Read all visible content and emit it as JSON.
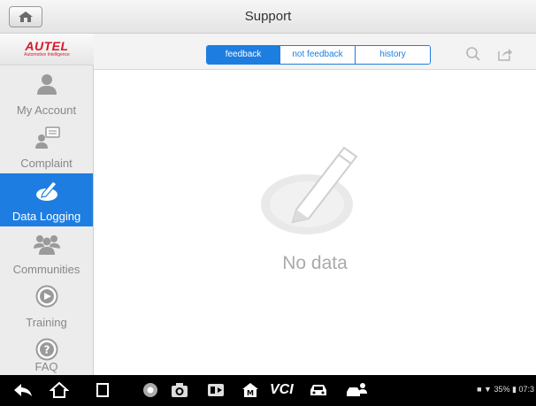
{
  "window": {
    "title": "Support"
  },
  "logo": {
    "brand": "AUTEL",
    "tagline": "Automotive Intelligence"
  },
  "sidebar": {
    "items": [
      {
        "label": "My Account",
        "icon": "person-icon",
        "active": false
      },
      {
        "label": "Complaint",
        "icon": "complaint-icon",
        "active": false
      },
      {
        "label": "Data Logging",
        "icon": "data-logging-icon",
        "active": true
      },
      {
        "label": "Communities",
        "icon": "communities-icon",
        "active": false
      },
      {
        "label": "Training",
        "icon": "play-circle-icon",
        "active": false
      },
      {
        "label": "FAQ",
        "icon": "question-circle-icon",
        "active": false
      }
    ]
  },
  "tabs": [
    {
      "label": "feedback",
      "selected": true
    },
    {
      "label": "not feedback",
      "selected": false
    },
    {
      "label": "history",
      "selected": false
    }
  ],
  "toolbar": {
    "icons": [
      "search-icon",
      "share-icon"
    ]
  },
  "main": {
    "empty_text": "No data"
  },
  "navbar": {
    "icons": [
      "back-icon",
      "home-icon",
      "recent-apps-icon",
      "chrome-icon",
      "camera-icon",
      "screenshot-icon",
      "autel-home-icon",
      "vci-icon",
      "car-icon",
      "car-service-icon"
    ],
    "vci_label": "VCI",
    "status_text": "35%",
    "clock": "07:3"
  },
  "colors": {
    "accent": "#1e7de0",
    "brand_red": "#d7182a",
    "sidebar_bg": "#ececec"
  }
}
